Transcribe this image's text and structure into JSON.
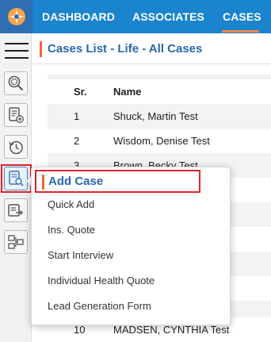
{
  "nav": {
    "items": [
      "DASHBOARD",
      "ASSOCIATES",
      "CASES"
    ],
    "active": "CASES"
  },
  "page": {
    "title": "Cases List - Life - All Cases"
  },
  "table": {
    "columns": [
      "Sr.",
      "Name"
    ],
    "rows": [
      {
        "sr": "1",
        "name": "Shuck, Martin Test"
      },
      {
        "sr": "2",
        "name": "Wisdom, Denise Test"
      },
      {
        "sr": "3",
        "name": "Brown, Becky Test"
      },
      {
        "sr": "10",
        "name": "MADSEN, CYNTHIA Test"
      }
    ]
  },
  "sidebar": {
    "icons": [
      "search-icon",
      "add-document-icon",
      "history-icon",
      "case-search-icon",
      "transfer-icon",
      "workflow-icon"
    ],
    "active": "case-search-icon"
  },
  "dropdown": {
    "title": "Add Case",
    "items": [
      "Quick Add",
      "Ins. Quote",
      "Start Interview",
      "Individual Health Quote",
      "Lead Generation Form"
    ]
  },
  "colors": {
    "topbar": "#1a84ce",
    "accent": "#f0643a",
    "title": "#2868b3",
    "highlight": "#e0232e"
  }
}
